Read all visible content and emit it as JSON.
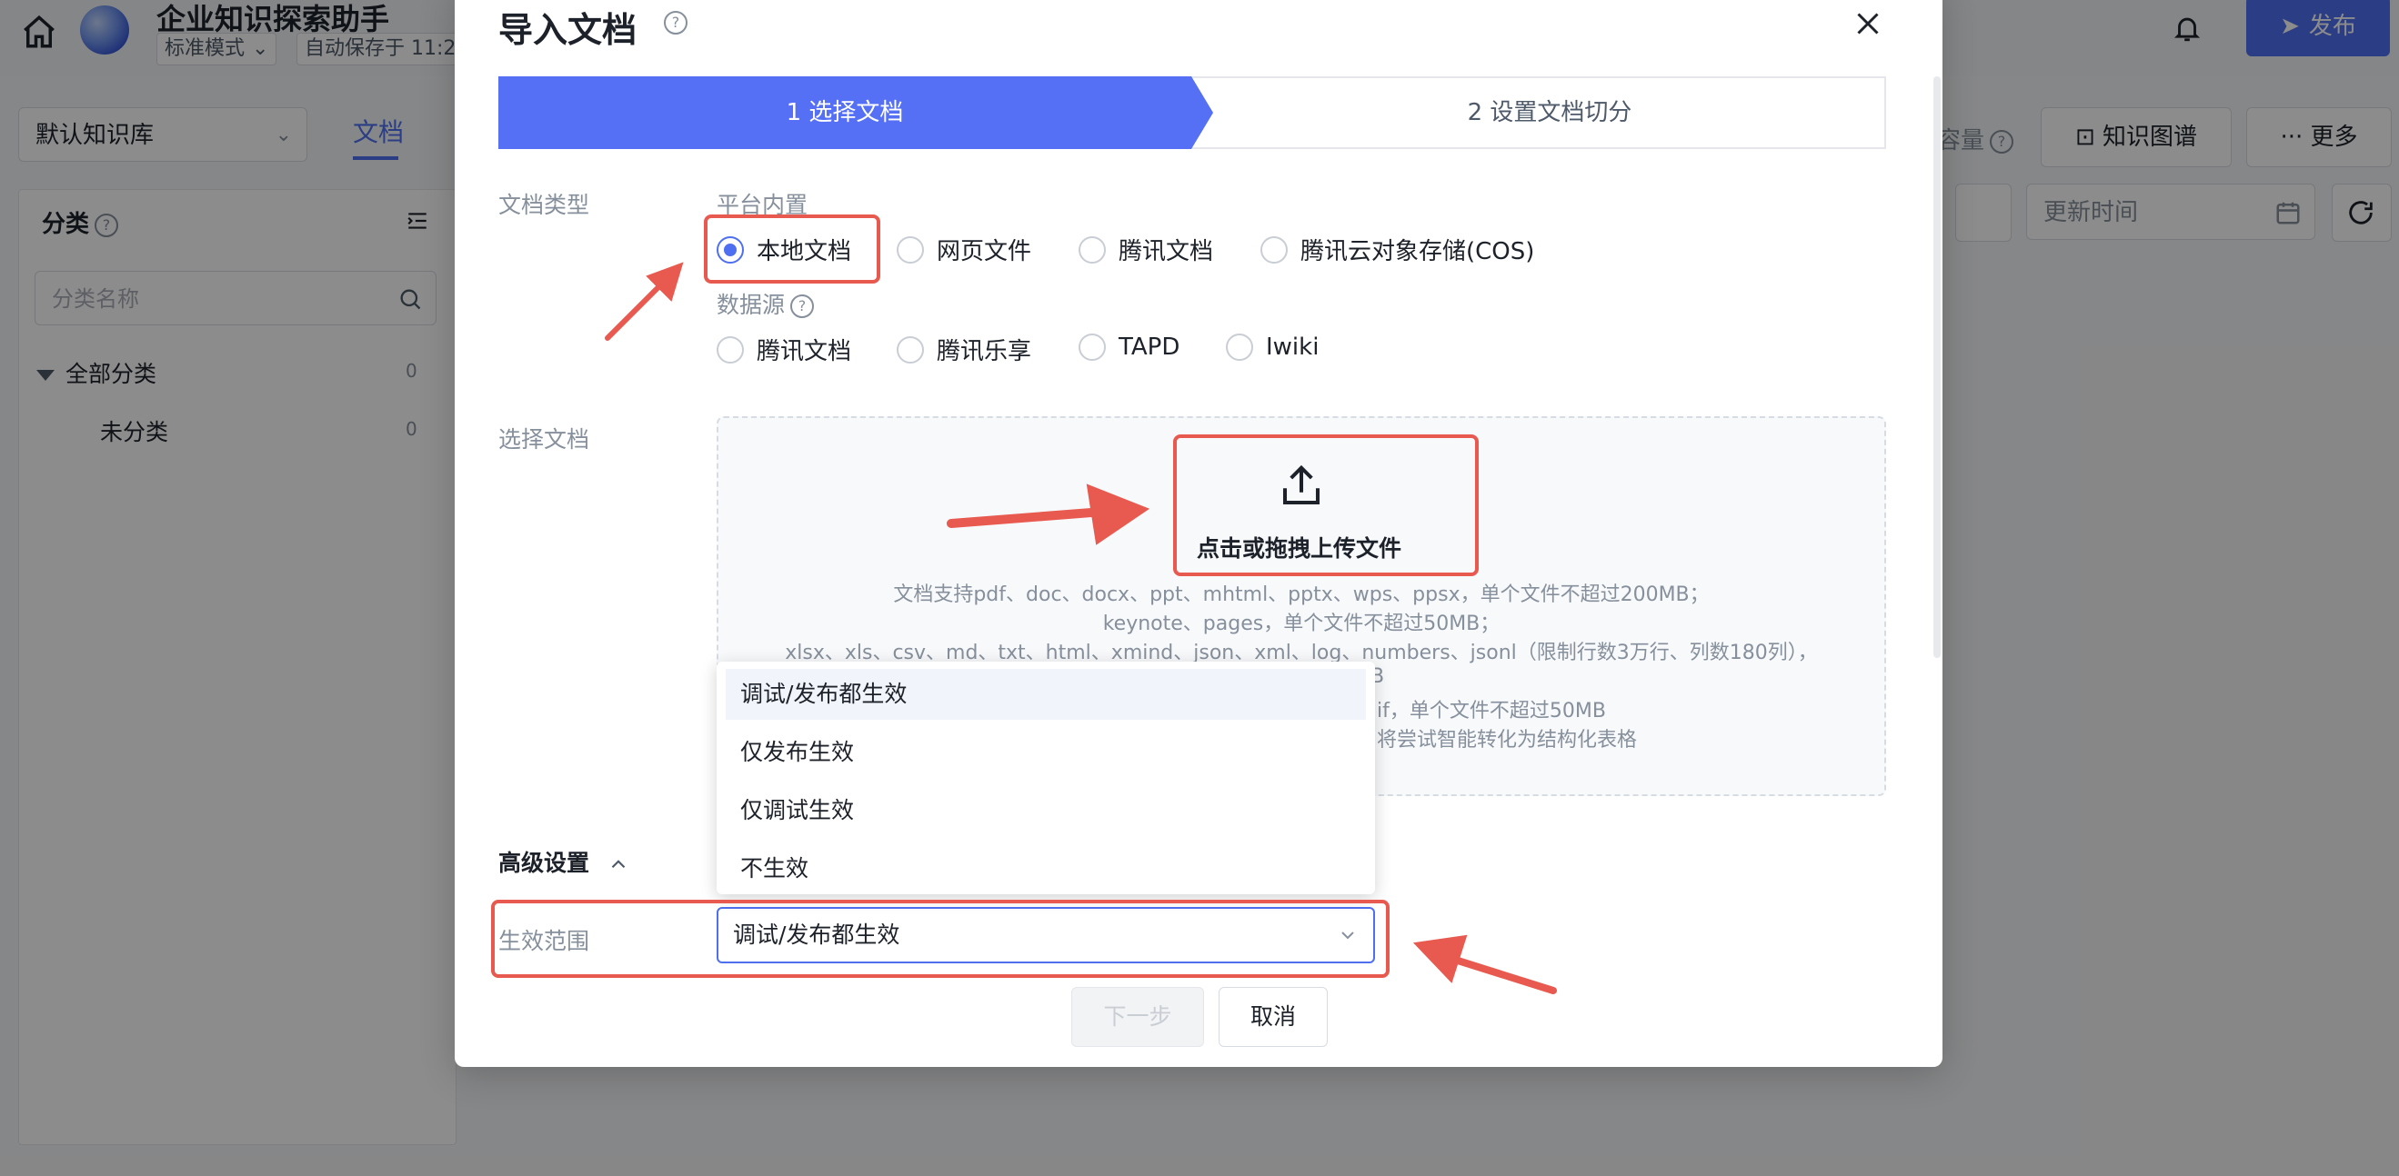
{
  "app": {
    "title": "企业知识探索助手",
    "mode": "标准模式",
    "autosave": "自动保存于 11:2",
    "publish_label": "发布"
  },
  "kb": {
    "select_value": "默认知识库",
    "tab_docs": "文档",
    "capacity_label": "容量",
    "kg_button": "知识图谱",
    "more_button": "更多",
    "update_time_placeholder": "更新时间"
  },
  "sidebar": {
    "title": "分类",
    "search_placeholder": "分类名称",
    "items": [
      {
        "label": "全部分类",
        "count": "0"
      },
      {
        "label": "未分类",
        "count": "0"
      }
    ]
  },
  "modal": {
    "title": "导入文档",
    "steps": [
      "1 选择文档",
      "2 设置文档切分"
    ],
    "doc_type_label": "文档类型",
    "platform_label": "平台内置",
    "platform_options": [
      "本地文档",
      "网页文件",
      "腾讯文档",
      "腾讯云对象存储(COS)"
    ],
    "datasource_label": "数据源",
    "datasource_options": [
      "腾讯文档",
      "腾讯乐享",
      "TAPD",
      "Iwiki"
    ],
    "select_doc_label": "选择文档",
    "upload_text": "点击或拖拽上传文件",
    "hints": [
      "文档支持pdf、doc、docx、ppt、mhtml、pptx、wps、ppsx，单个文件不超过200MB；",
      "keynote、pages，单个文件不超过50MB；",
      "xlsx、xls、csv、md、txt、html、xmind、json、xml、log、numbers、jsonl（限制行数3万行、列数180列），",
      "MB",
      "if，单个文件不超过50MB",
      "将尝试智能转化为结构化表格"
    ],
    "advanced_label": "高级设置",
    "scope_label": "生效范围",
    "scope_value": "调试/发布都生效",
    "scope_options": [
      "调试/发布都生效",
      "仅发布生效",
      "仅调试生效",
      "不生效"
    ],
    "next_button": "下一步",
    "cancel_button": "取消"
  },
  "colors": {
    "primary": "#4f6ff1",
    "annotation_red": "#e85a4f"
  }
}
